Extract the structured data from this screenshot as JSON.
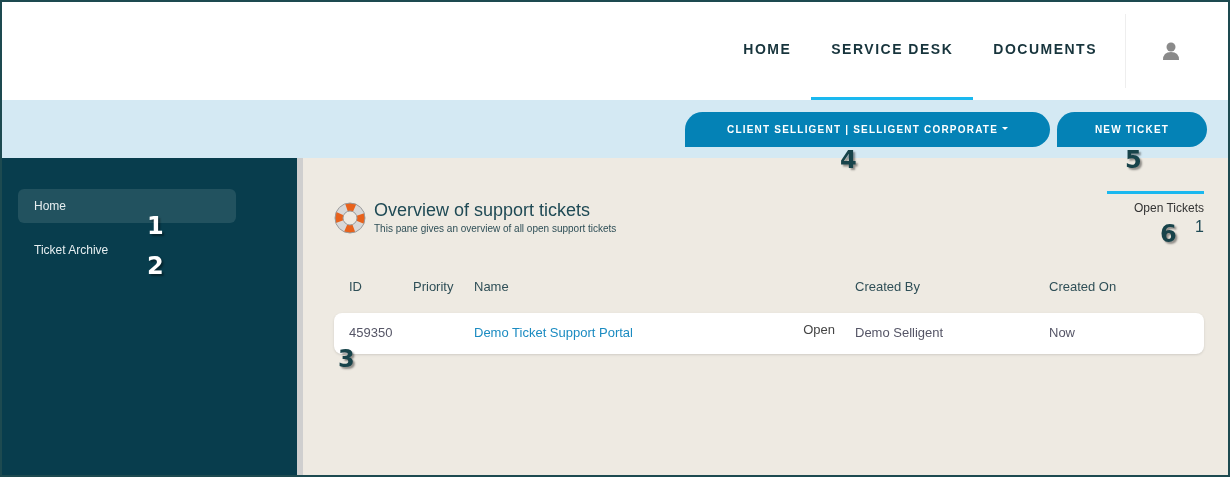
{
  "nav": [
    {
      "label": "HOME",
      "selected": false
    },
    {
      "label": "SERVICE DESK",
      "selected": true
    },
    {
      "label": "DOCUMENTS",
      "selected": false
    }
  ],
  "toolbar": {
    "client_button": "CLIENT SELLIGENT | SELLIGENT CORPORATE",
    "new_ticket_button": "NEW TICKET"
  },
  "sidebar": {
    "items": [
      {
        "label": "Home",
        "selected": true
      },
      {
        "label": "Ticket Archive",
        "selected": false
      }
    ]
  },
  "overview": {
    "title": "Overview of support tickets",
    "subtitle": "This pane gives an overview of all open support tickets",
    "stat_label": "Open Tickets",
    "stat_value": "1"
  },
  "table": {
    "columns": [
      "ID",
      "Priority",
      "Name",
      "Created By",
      "Created On"
    ],
    "rows": [
      {
        "id": "459350",
        "name": "Demo Ticket Support Portal",
        "status": "Open",
        "created_by": "Demo Selligent",
        "created_on": "Now"
      }
    ]
  },
  "annotations": [
    {
      "label": "1",
      "color": "#ffffff"
    },
    {
      "label": "2",
      "color": "#ffffff"
    },
    {
      "label": "3",
      "color": "#17434a"
    },
    {
      "label": "4",
      "color": "#17434a"
    },
    {
      "label": "5",
      "color": "#17434a"
    },
    {
      "label": "6",
      "color": "#17434a"
    }
  ]
}
